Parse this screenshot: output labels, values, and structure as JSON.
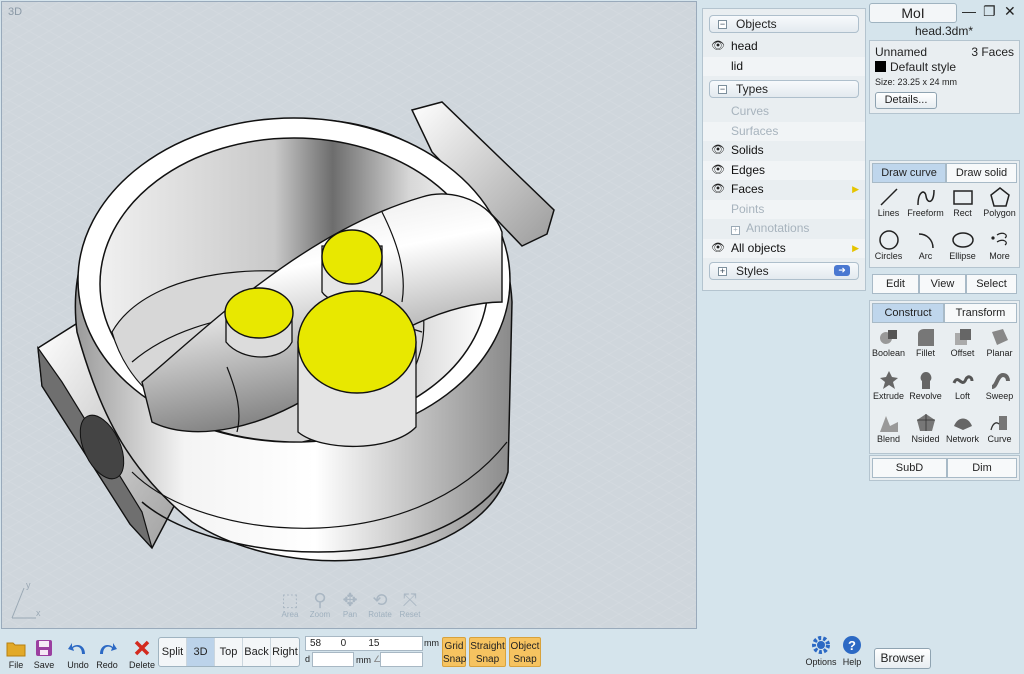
{
  "viewport": {
    "label": "3D",
    "nav_tools": [
      {
        "name": "area",
        "label": "Area",
        "icon": "⬚"
      },
      {
        "name": "zoom",
        "label": "Zoom",
        "icon": "⚲"
      },
      {
        "name": "pan",
        "label": "Pan",
        "icon": "✥"
      },
      {
        "name": "rotate",
        "label": "Rotate",
        "icon": "⟲"
      },
      {
        "name": "reset",
        "label": "Reset",
        "icon": "⤧"
      }
    ],
    "axis": {
      "y": "y",
      "x": "x"
    }
  },
  "scene": {
    "objects_header": "Objects",
    "objects": [
      {
        "label": "head",
        "visible": true
      },
      {
        "label": "lid",
        "visible": false
      }
    ],
    "types_header": "Types",
    "types": [
      {
        "label": "Curves",
        "dim": true
      },
      {
        "label": "Surfaces",
        "dim": true
      },
      {
        "label": "Solids",
        "eye": true
      },
      {
        "label": "Edges",
        "eye": true
      },
      {
        "label": "Faces",
        "eye": true,
        "arrow": true
      },
      {
        "label": "Points",
        "dim": true
      },
      {
        "label": "Annotations",
        "dim": true,
        "plus": true
      },
      {
        "label": "All objects",
        "eye": true,
        "arrow": true
      }
    ],
    "styles_header": "Styles"
  },
  "app": {
    "title": "MoI",
    "filename": "head.3dm*"
  },
  "properties": {
    "name": "Unnamed",
    "count": "3 Faces",
    "style": "Default style",
    "size": "Size: 23.25 x 24 mm",
    "details_button": "Details..."
  },
  "draw_tabs": [
    "Draw curve",
    "Draw solid"
  ],
  "draw_tools": [
    {
      "label": "Lines",
      "icon": "lines-icon"
    },
    {
      "label": "Freeform",
      "icon": "freeform-icon"
    },
    {
      "label": "Rect",
      "icon": "rect-icon"
    },
    {
      "label": "Polygon",
      "icon": "polygon-icon"
    },
    {
      "label": "Circles",
      "icon": "circle-icon"
    },
    {
      "label": "Arc",
      "icon": "arc-icon"
    },
    {
      "label": "Ellipse",
      "icon": "ellipse-icon"
    },
    {
      "label": "More",
      "icon": "more-icon"
    }
  ],
  "edit_tabs": [
    "Edit",
    "View",
    "Select"
  ],
  "construct_tabs": [
    "Construct",
    "Transform"
  ],
  "construct_tools": [
    {
      "label": "Boolean"
    },
    {
      "label": "Fillet"
    },
    {
      "label": "Offset"
    },
    {
      "label": "Planar"
    },
    {
      "label": "Extrude"
    },
    {
      "label": "Revolve"
    },
    {
      "label": "Loft"
    },
    {
      "label": "Sweep"
    },
    {
      "label": "Blend"
    },
    {
      "label": "Nsided"
    },
    {
      "label": "Network"
    },
    {
      "label": "Curve"
    }
  ],
  "misc_tabs": [
    "SubD",
    "Dim"
  ],
  "bottom": {
    "file": "File",
    "save": "Save",
    "undo": "Undo",
    "redo": "Redo",
    "delete": "Delete",
    "views": [
      "Split",
      "3D",
      "Top",
      "Back",
      "Right"
    ],
    "coord_x": "58",
    "coord_y": "0",
    "coord_z": "15",
    "unit": "mm",
    "d_label": "d",
    "d_unit": "mm",
    "angle_symbol": "∠",
    "grid_snap": [
      "Grid",
      "Snap"
    ],
    "straight_snap": [
      "Straight",
      "Snap"
    ],
    "object_snap": [
      "Object",
      "Snap"
    ],
    "options": "Options",
    "help": "Help",
    "browser": "Browser"
  },
  "colors": {
    "accent": "#bfd6ec",
    "snap": "#f6c360",
    "selection": "#e8e800"
  }
}
